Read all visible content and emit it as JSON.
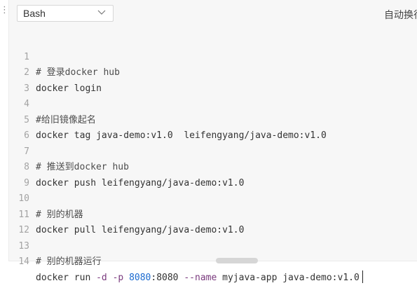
{
  "toolbar": {
    "language": "Bash",
    "auto_label": "自动换行"
  },
  "icons": {
    "left_edge": "more-dots",
    "language_dropdown": "chevron-down",
    "accent": "#1c6bd0"
  },
  "lines": [
    {
      "n": "1",
      "text": "# 登录docker hub"
    },
    {
      "n": "2",
      "text": "docker login"
    },
    {
      "n": "3",
      "text": ""
    },
    {
      "n": "4",
      "text": "#给旧镜像起名"
    },
    {
      "n": "5",
      "text": "docker tag java-demo:v1.0  leifengyang/java-demo:v1.0"
    },
    {
      "n": "6",
      "text": ""
    },
    {
      "n": "7",
      "text": "# 推送到docker hub"
    },
    {
      "n": "8",
      "text": "docker push leifengyang/java-demo:v1.0"
    },
    {
      "n": "9",
      "text": ""
    },
    {
      "n": "10",
      "text": "# 别的机器"
    },
    {
      "n": "11",
      "text": "docker pull leifengyang/java-demo:v1.0"
    },
    {
      "n": "12",
      "text": ""
    },
    {
      "n": "13",
      "text": "# 别的机器运行"
    },
    {
      "n": "14",
      "text": "docker run -d -p 8080:8080 --name myjava-app java-demo:v1.0"
    }
  ],
  "line14": {
    "t1": "docker run ",
    "opt1": "-d",
    "t2": " ",
    "opt2": "-p",
    "t3": " ",
    "num1": "8080",
    "t4": ":8080 ",
    "opt3": "--name",
    "t5": " myjava-app java-demo:v1.0"
  }
}
